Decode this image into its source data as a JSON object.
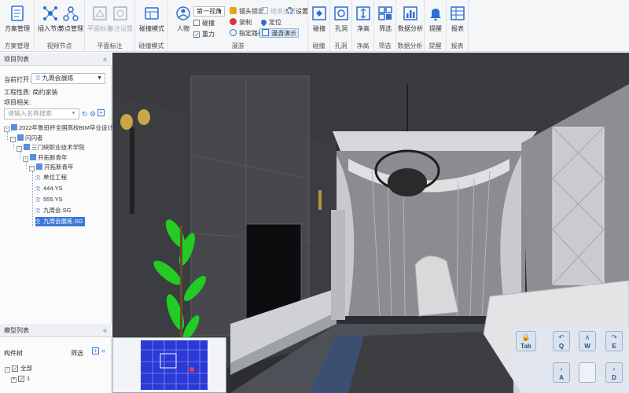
{
  "ribbon": {
    "groups": {
      "scheme": "方案管理",
      "nodes": "视频节点",
      "plane": "平面标注",
      "roaming_mode": "碰撞模式",
      "roam": "漫游",
      "collision": "碰撞",
      "hole": "孔洞",
      "clearance": "净高",
      "filter": "筛选",
      "data_analysis": "数据分析",
      "remind": "提醒",
      "report": "报表"
    },
    "buttons": {
      "scheme_mgmt": "方案管理",
      "insert_node": "插入节点",
      "node_mgmt": "节点管理",
      "plane_mark": "平面标注",
      "mark_settings": "标注设置",
      "collision_mode": "碰撞模式",
      "person": "人物",
      "collision": "碰撞",
      "hole": "孔洞",
      "clearance": "净高",
      "filter": "筛选",
      "data_analysis": "数据分析",
      "remind": "提醒",
      "report": "报表"
    },
    "view_dropdown": "第一视角",
    "checks": {
      "collide": "碰撞",
      "gravity": "重力"
    },
    "small": {
      "lens_lock": "镜头锁定",
      "record": "录制",
      "designated_path": "指定路径",
      "end_settings": "结束设置",
      "locate": "定位",
      "roam_demo": "漫游演示",
      "settings": "设置"
    }
  },
  "left_panel": {
    "project_list_title": "项目列表",
    "current_open_label": "当前打开:",
    "current_open_value": "九周会展练",
    "project_type_label": "工程性质:",
    "project_type_value": "简约家装",
    "project_related_label": "项目相关:",
    "search_placeholder": "请输入名称搜索",
    "tree": [
      "2022年鲁班杯全国高校BIM毕业设计作",
      "闪闪者",
      "三门峡职业技术学院",
      "开拓新青年",
      "开拓新青年",
      "单位工程",
      "444.YS",
      "555.YS",
      "九周会.SG",
      "九周会展练.SG"
    ],
    "model_list_title": "模型列表",
    "component_tree_label": "构件树",
    "filter_label": "筛选",
    "model_tree": [
      "全部",
      "1"
    ]
  },
  "navpad": {
    "keys": {
      "tab": "Tab",
      "q": "Q",
      "w": "W",
      "e": "E",
      "a": "A",
      "d": "D"
    }
  },
  "colors": {
    "accent": "#3b78d8",
    "ribbon_bg": "#f5f6f8",
    "viewport_bg": "#2d2e31"
  }
}
